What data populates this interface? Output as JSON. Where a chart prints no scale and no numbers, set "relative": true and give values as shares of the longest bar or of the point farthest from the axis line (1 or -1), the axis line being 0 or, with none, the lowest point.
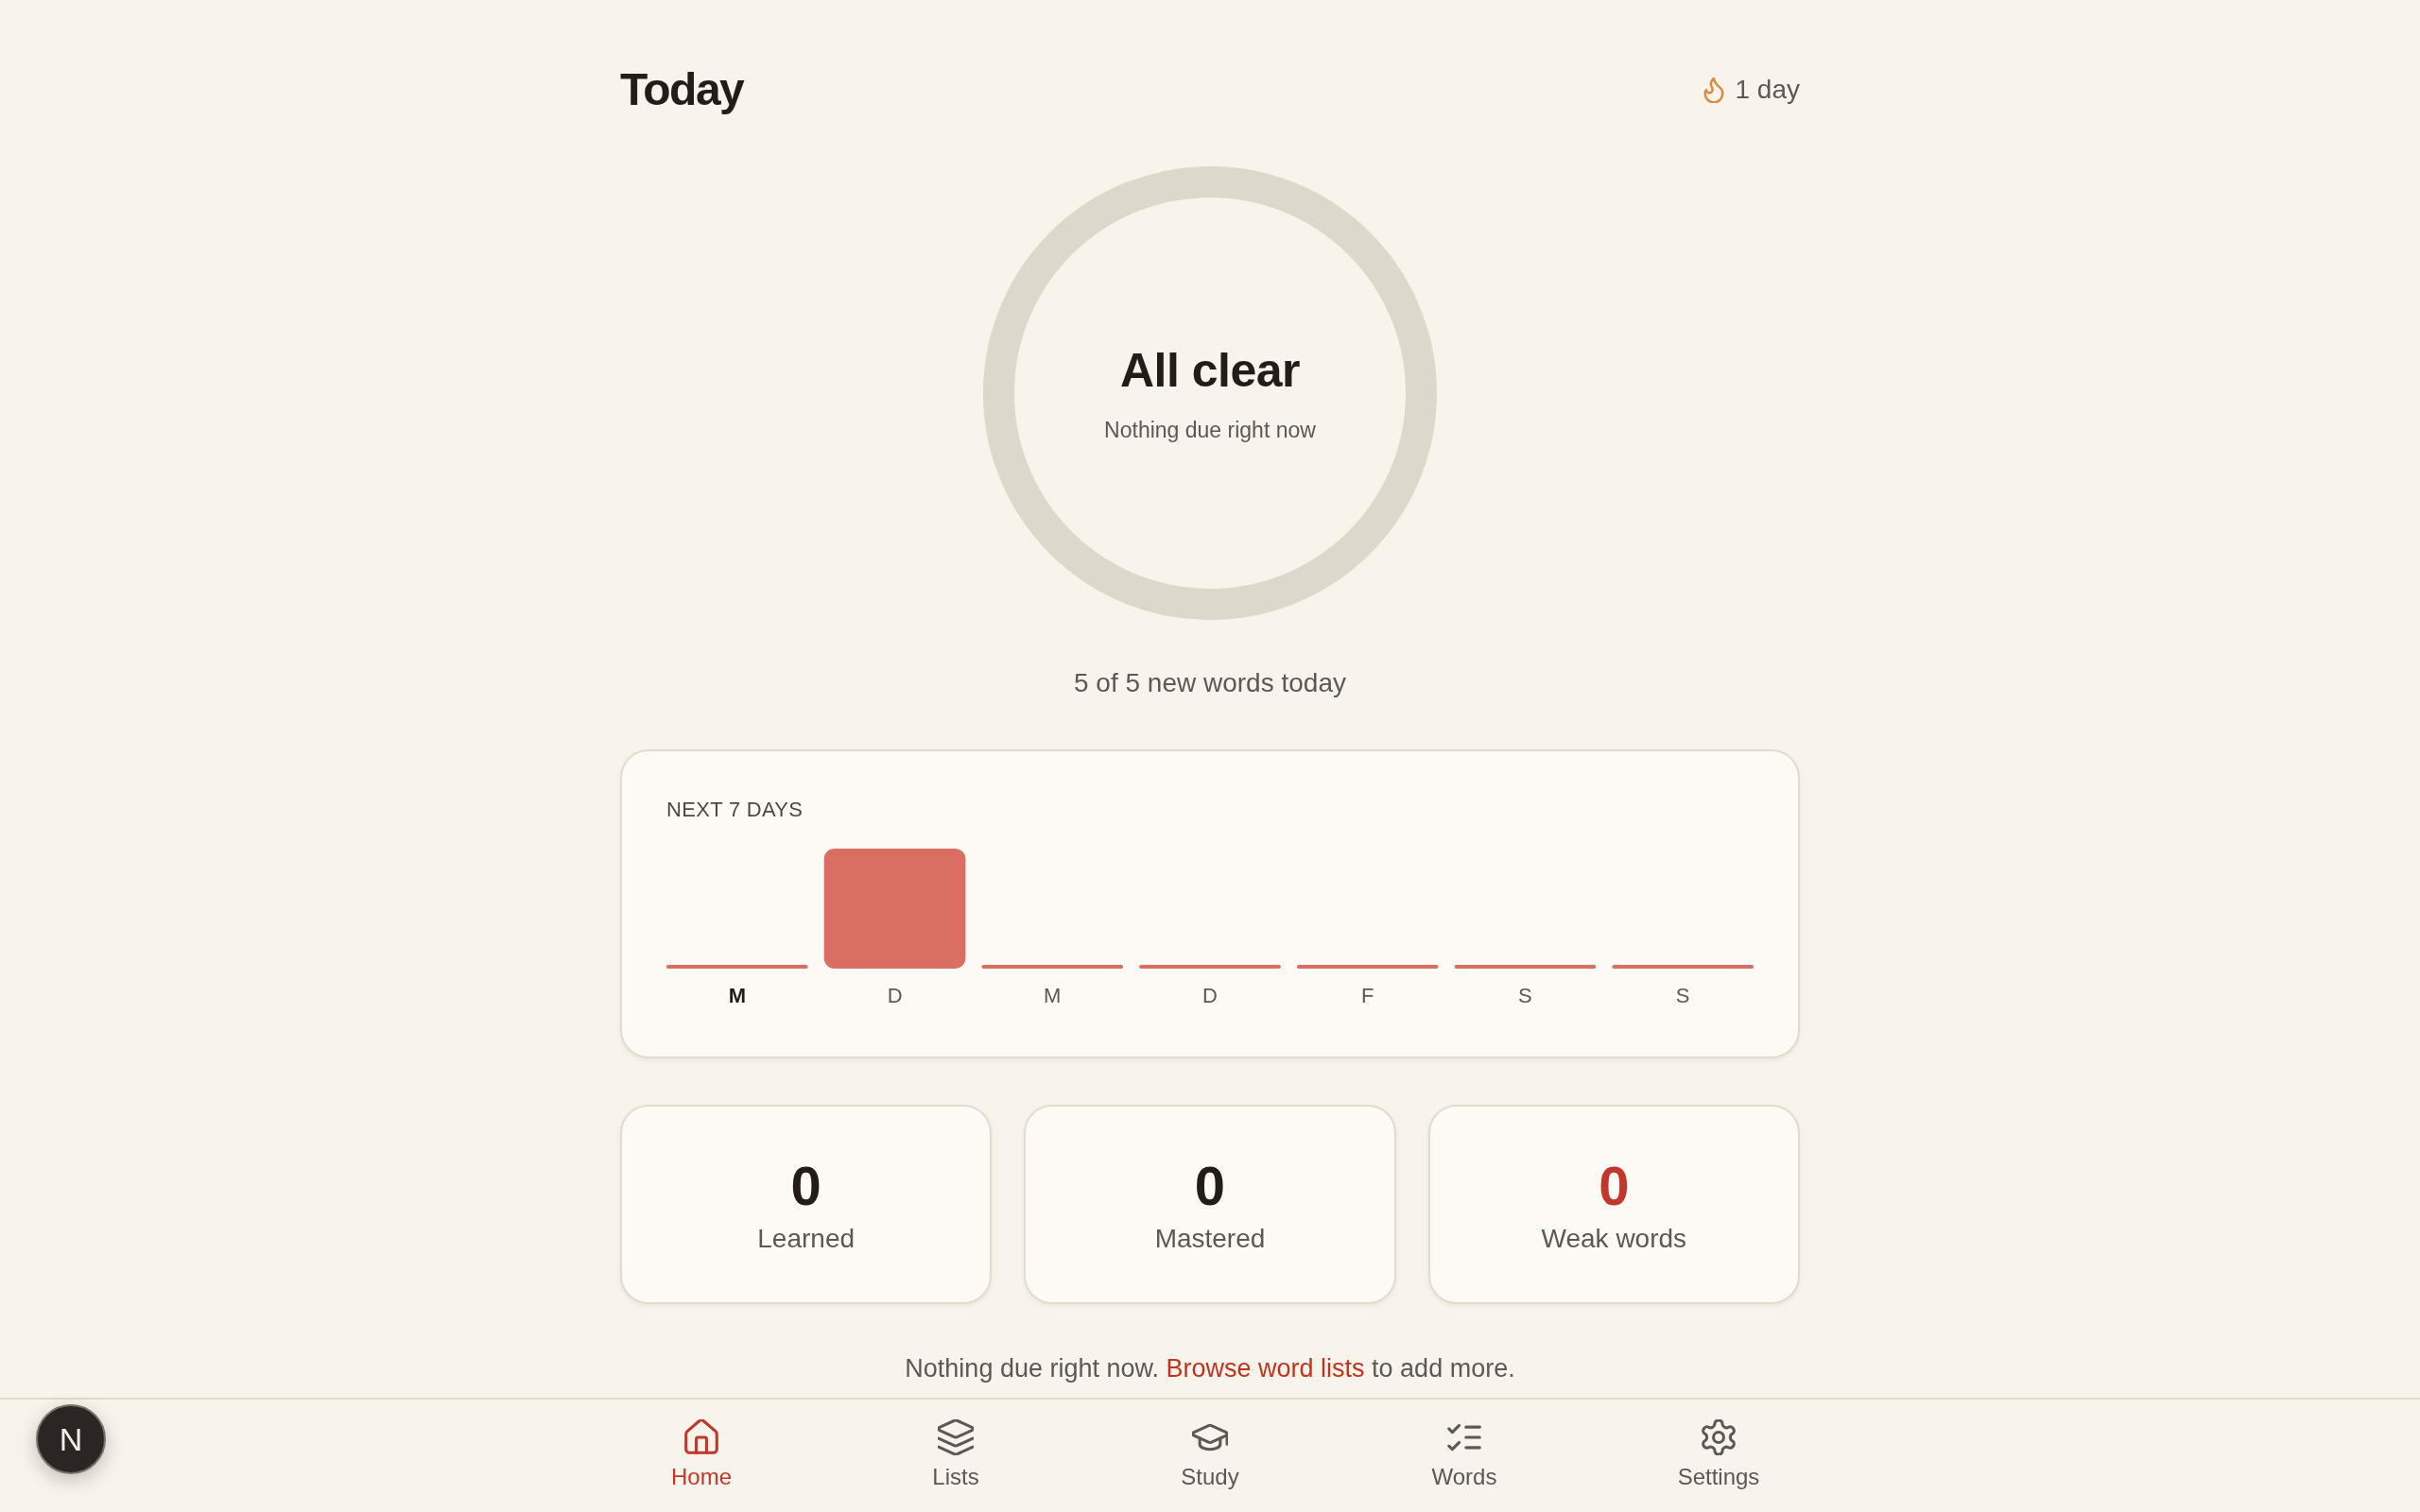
{
  "header": {
    "title": "Today",
    "streak": "1 day"
  },
  "summary": {
    "title": "All clear",
    "subtitle": "Nothing due right now",
    "new_words": "5 of 5 new words today"
  },
  "forecast": {
    "title": "NEXT 7 DAYS",
    "chart_data": {
      "type": "bar",
      "relative": true,
      "categories": [
        "M",
        "D",
        "M",
        "D",
        "F",
        "S",
        "S"
      ],
      "values": [
        0,
        1,
        0,
        0,
        0,
        0,
        0
      ]
    },
    "days": [
      {
        "selected": true
      },
      {
        "selected": false
      },
      {
        "selected": false
      },
      {
        "selected": false
      },
      {
        "selected": false
      },
      {
        "selected": false
      },
      {
        "selected": false
      }
    ]
  },
  "stats": [
    {
      "value": "0",
      "label": "Learned",
      "color": "#231c17"
    },
    {
      "value": "0",
      "label": "Mastered",
      "color": "#231c17"
    },
    {
      "value": "0",
      "label": "Weak words",
      "color": "#c4352a"
    }
  ],
  "footer": {
    "before": "Nothing due right now.",
    "link": "Browse word lists",
    "after": "to add more."
  },
  "nav": [
    {
      "label": "Home",
      "selected": true
    },
    {
      "label": "Lists",
      "selected": false
    },
    {
      "label": "Study",
      "selected": false
    },
    {
      "label": "Words",
      "selected": false
    },
    {
      "label": "Settings",
      "selected": false
    }
  ],
  "dev_badge": {
    "label": "N"
  }
}
